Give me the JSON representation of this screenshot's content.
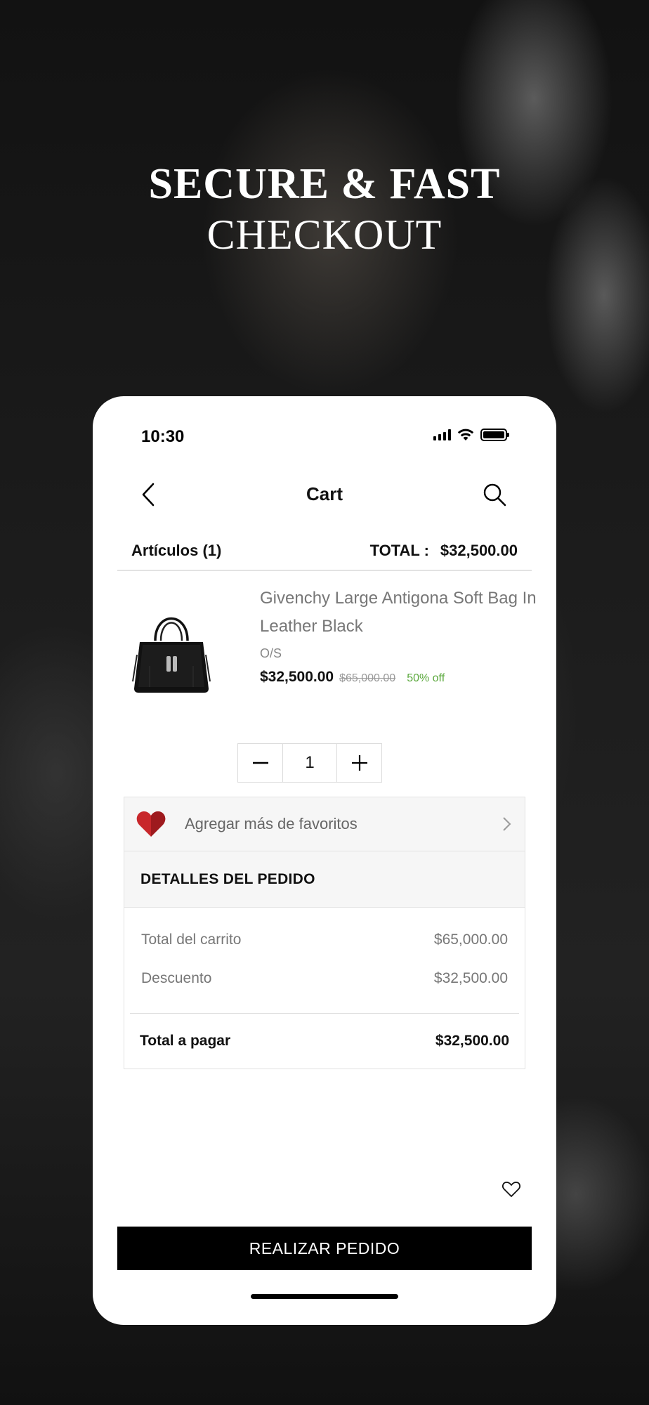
{
  "hero": {
    "line1": "SECURE & FAST",
    "line2": "CHECKOUT"
  },
  "status_bar": {
    "time": "10:30",
    "icons": [
      "signal-icon",
      "wifi-icon",
      "battery-icon"
    ]
  },
  "nav": {
    "back_icon": "chevron-left-icon",
    "title": "Cart",
    "search_icon": "search-icon"
  },
  "summary": {
    "items_label": "Artículos (1)",
    "total_label": "TOTAL :",
    "total_value": "$32,500.00"
  },
  "product": {
    "name": "Givenchy Large Antigona Soft Bag In Leather Black",
    "size": "O/S",
    "price": "$32,500.00",
    "original_price": "$65,000.00",
    "discount": "50% off",
    "image": "black-leather-bag"
  },
  "quantity": {
    "value": "1",
    "minus_icon": "minus-icon",
    "plus_icon": "plus-icon"
  },
  "favorites": {
    "label": "Agregar más de favoritos",
    "icon": "heart-icon",
    "chevron": "chevron-right-icon"
  },
  "order_details": {
    "heading": "DETALLES DEL PEDIDO",
    "lines": [
      {
        "label": "Total del carrito",
        "value": "$65,000.00"
      },
      {
        "label": "Descuento",
        "value": "$32,500.00"
      }
    ],
    "total_label": "Total a pagar",
    "total_value": "$32,500.00"
  },
  "actions": {
    "wishlist_icon": "heart-outline-icon",
    "order_button": "REALIZAR PEDIDO"
  },
  "colors": {
    "accent": "#000000",
    "discount": "#5aa83c",
    "heart": "#c8272b"
  }
}
